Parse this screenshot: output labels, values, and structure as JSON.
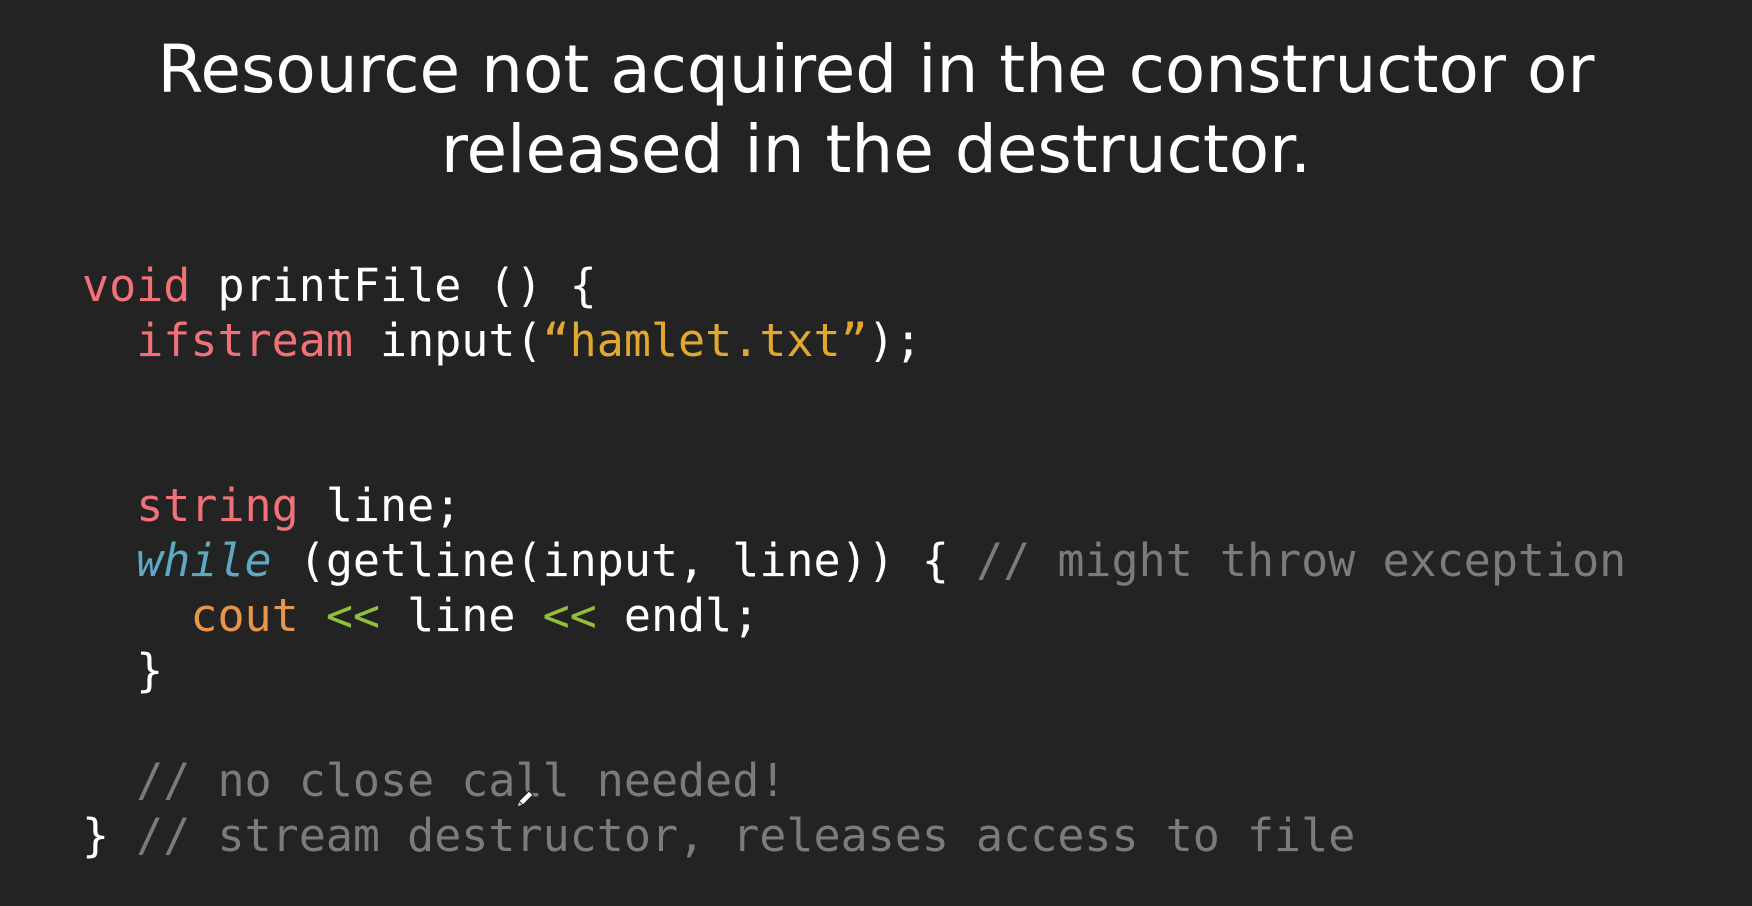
{
  "title": {
    "line1": "Resource not acquired in the constructor or",
    "line2": "released in the destructor."
  },
  "code": {
    "line1": {
      "keyword": "void",
      "rest": " printFile () {"
    },
    "line2": {
      "indent": "  ",
      "type": "ifstream",
      "call": " input(",
      "string": "“hamlet.txt”",
      "end": ");"
    },
    "line3": {
      "indent": "  ",
      "type": "string",
      "rest": " line;"
    },
    "line4": {
      "indent": "  ",
      "keyword": "while",
      "rest": " (getline(input, line)) { ",
      "comment": "// might throw exception"
    },
    "line5": {
      "indent": "    ",
      "object": "cout",
      "sp1": " ",
      "op1": "<<",
      "mid": " line ",
      "op2": "<<",
      "end": " endl;"
    },
    "line6": {
      "text": "  }"
    },
    "line7": {
      "indent": "  ",
      "comment": "// no close call needed!"
    },
    "line8": {
      "brace": "}",
      "comment": " // stream destructor, releases access to file"
    }
  },
  "colors": {
    "background": "#232323",
    "keyword": "#f07178",
    "string": "#e0a82e",
    "italic_keyword": "#5ea8c4",
    "object": "#e8954a",
    "operator": "#8fbf3b",
    "comment": "#7b7b7b"
  },
  "cursor": {
    "icon": "pen-cursor-icon"
  }
}
